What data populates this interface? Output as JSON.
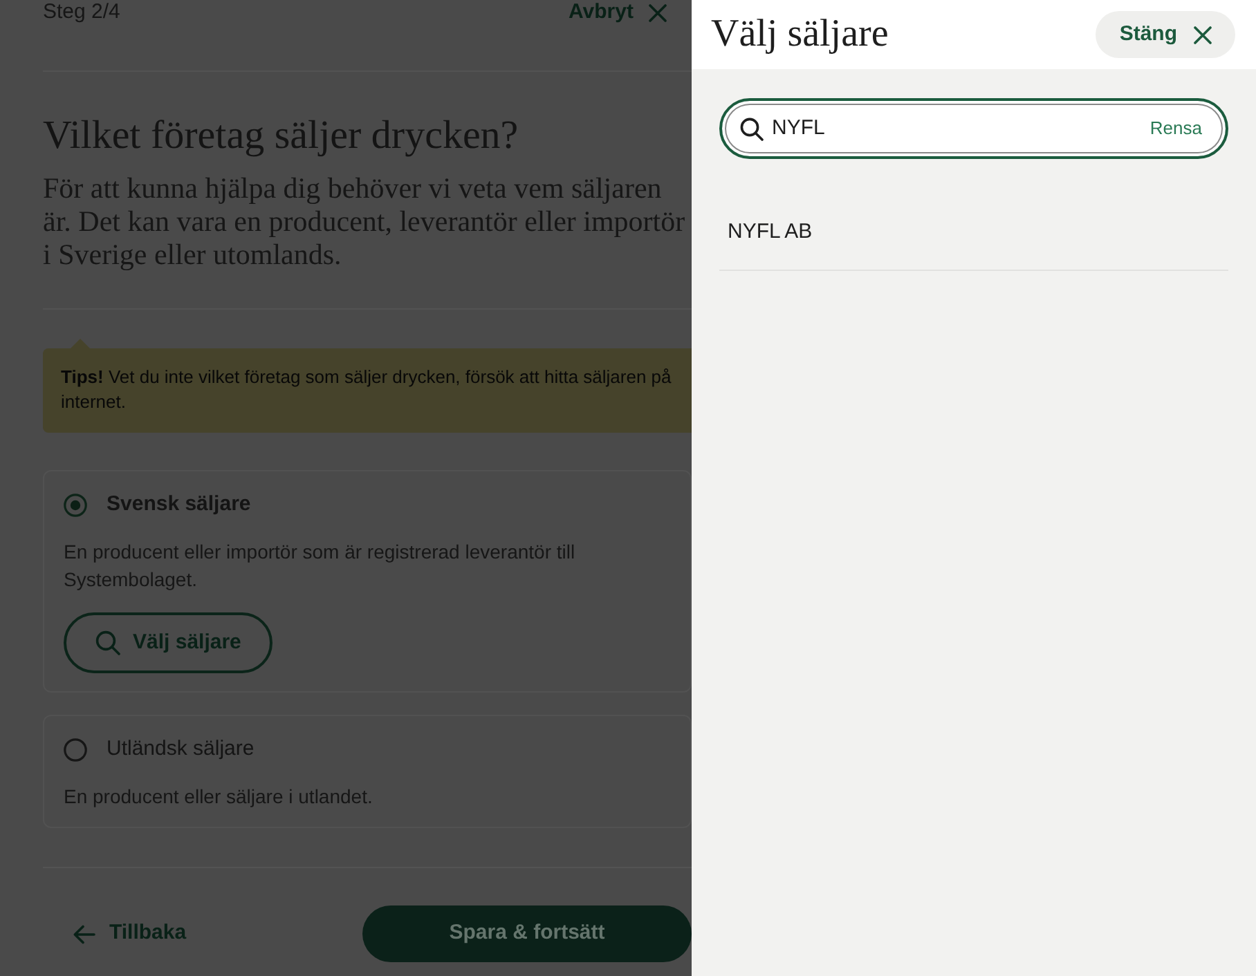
{
  "page": {
    "step": "Steg 2/4",
    "cancel": "Avbryt",
    "heading": "Vilket företag säljer drycken?",
    "intro": "För att kunna hjälpa dig behöver vi veta vem säljaren är. Det kan vara en producent, leverantör eller importör i Sverige eller utomlands.",
    "tip": "**Tips!** Vet du inte vilket företag som säljer drycken, försök att hitta säljaren på internet.",
    "options": [
      {
        "label": "Svensk säljare",
        "selected": true,
        "description": "En producent eller importör som är registrerad leverantör till Systembolaget.",
        "button": "Välj säljare"
      },
      {
        "label": "Utländsk säljare",
        "selected": false,
        "description": "En producent eller säljare i utlandet."
      }
    ],
    "back": "Tillbaka",
    "submit": "Spara & fortsätt"
  },
  "panel": {
    "title": "Välj säljare",
    "close": "Stäng",
    "search": {
      "value": "NYFL",
      "clear": "Rensa"
    },
    "results": [
      "NYFL AB"
    ]
  }
}
